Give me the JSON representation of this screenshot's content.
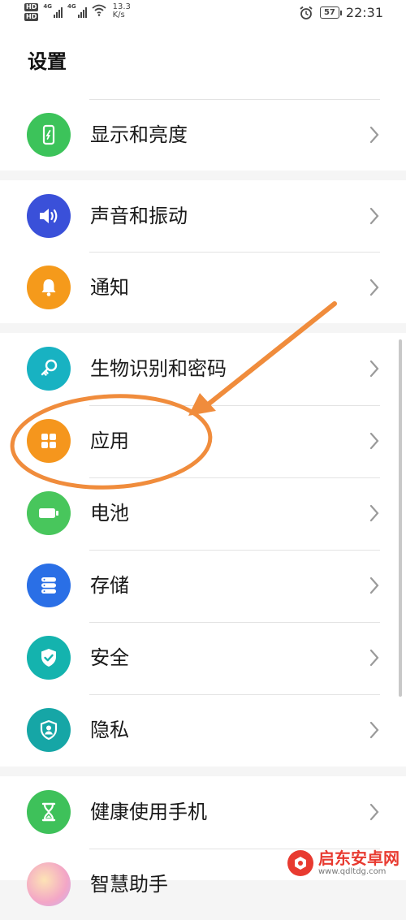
{
  "status_bar": {
    "hd_label": "HD",
    "network_label": "4G",
    "speed_value": "13.3",
    "speed_unit": "K/s",
    "battery_level": "57",
    "time": "22:31"
  },
  "header": {
    "title": "设置"
  },
  "groups": [
    {
      "items": [
        {
          "label": "显示和亮度",
          "icon": "display-brightness-icon",
          "color": "#3cc35a"
        }
      ]
    },
    {
      "items": [
        {
          "label": "声音和振动",
          "icon": "speaker-icon",
          "color": "#3a50d9"
        },
        {
          "label": "通知",
          "icon": "bell-icon",
          "color": "#f59a1b"
        }
      ]
    },
    {
      "items": [
        {
          "label": "生物识别和密码",
          "icon": "key-icon",
          "color": "#18b2c2"
        },
        {
          "label": "应用",
          "icon": "apps-grid-icon",
          "color": "#f5961d"
        },
        {
          "label": "电池",
          "icon": "battery-icon",
          "color": "#48c65c"
        },
        {
          "label": "存储",
          "icon": "storage-icon",
          "color": "#2a6fe6"
        },
        {
          "label": "安全",
          "icon": "shield-check-icon",
          "color": "#14b3ae"
        },
        {
          "label": "隐私",
          "icon": "privacy-shield-icon",
          "color": "#16a6a6"
        }
      ]
    },
    {
      "items": [
        {
          "label": "健康使用手机",
          "icon": "hourglass-icon",
          "color": "#3ec15a"
        },
        {
          "label": "智慧助手",
          "icon": "assistant-icon",
          "color": "#e9a3c8"
        }
      ]
    }
  ],
  "annotation": {
    "color": "#f08c3c",
    "target": "应用"
  },
  "watermark": {
    "name": "启东安卓网",
    "url": "www.qdltdg.com"
  }
}
